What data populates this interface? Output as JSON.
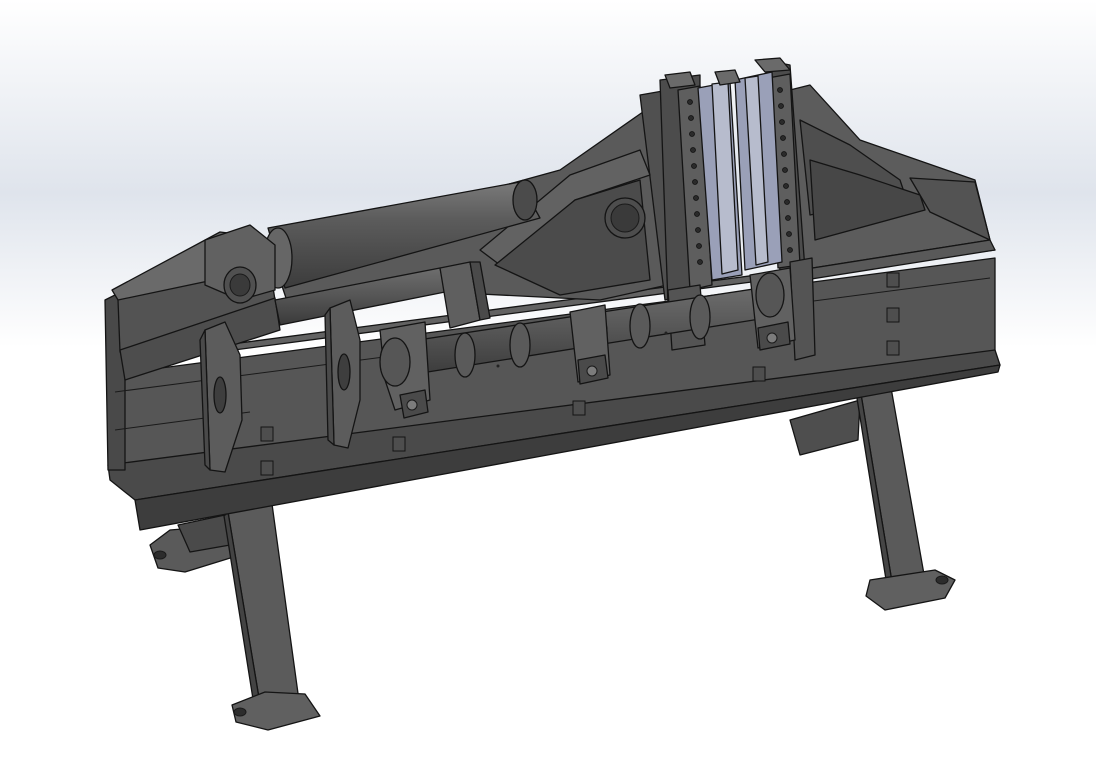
{
  "viewport": {
    "background_top": "#c9d0dc",
    "background_bottom": "#ffffff",
    "view": "isometric"
  },
  "model": {
    "part_type": "machine-frame-assembly",
    "body_color": "#585858",
    "body_dark": "#3b3b3b",
    "body_light": "#6d6d6d",
    "edge_color": "#141414",
    "guide_color": "#9aa0b8",
    "guide_light": "#b7bccd",
    "features": [
      "hydraulic-cylinder",
      "shaft-with-clamp-brackets",
      "vertical-guide-plates",
      "support-legs",
      "mounting-feet"
    ]
  }
}
